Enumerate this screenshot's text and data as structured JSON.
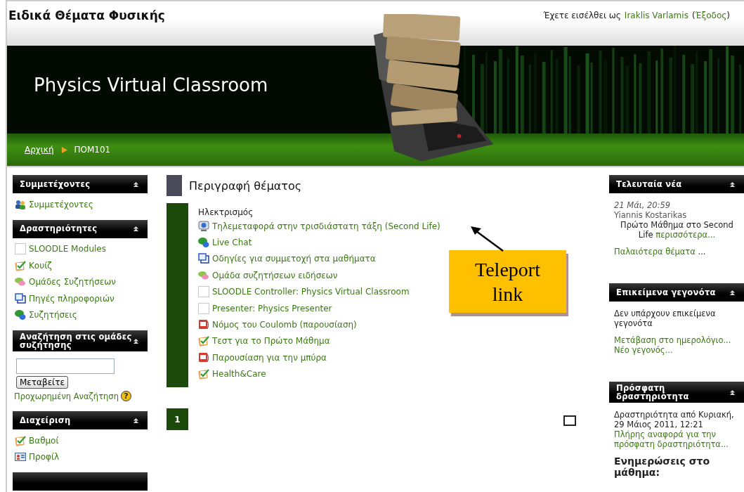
{
  "header": {
    "site_title": "Ειδικά Θέματα Φυσικής",
    "login_prefix": "Έχετε εισέλθει ως",
    "user": "Iraklis Varlamis",
    "logout_open": "(",
    "logout": "Έξοδος",
    "logout_close": ")"
  },
  "banner": {
    "title": "Physics Virtual Classroom"
  },
  "breadcrumb": [
    {
      "label": "Αρχική",
      "kind": "link"
    },
    {
      "label": "ΠΟΜ101",
      "kind": "current"
    }
  ],
  "left_blocks": [
    {
      "kind": "links",
      "title": "Συμμετέχοντες",
      "items": [
        {
          "kind": "participants",
          "label": "Συμμετέχοντες"
        }
      ]
    },
    {
      "kind": "links",
      "title": "Δραστηριότητες",
      "items": [
        {
          "kind": "blank",
          "label": "SLOODLE Modules"
        },
        {
          "kind": "quiz",
          "label": "Κουίζ"
        },
        {
          "kind": "forum",
          "label": "Ομάδες Συζητήσεων"
        },
        {
          "kind": "resource",
          "label": "Πηγές πληροφοριών"
        },
        {
          "kind": "chat",
          "label": "Συζητήσεις"
        }
      ]
    },
    {
      "kind": "search",
      "title": "Αναζήτηση στις ομάδες συζήτησης",
      "button": "Μεταβείτε",
      "advanced": "Προχωρημένη Αναζήτηση",
      "help_icon": "?"
    },
    {
      "kind": "links",
      "title": "Διαχείριση",
      "items": [
        {
          "kind": "quiz",
          "label": "Βαθμοί"
        },
        {
          "kind": "profile",
          "label": "Προφίλ"
        }
      ]
    }
  ],
  "section": {
    "title": "Περιγραφή θέματος",
    "summary": "Ηλεκτρισμός",
    "activities": [
      {
        "kind": "teleport",
        "label": "Τηλεμεταφορά στην τρισδιάστατη τάξη (Second Life)"
      },
      {
        "kind": "chat",
        "label": "Live Chat"
      },
      {
        "kind": "resource",
        "label": "Οδηγίες για συμμετοχή στα μαθήματα"
      },
      {
        "kind": "forum",
        "label": "Ομάδα συζητήσεων ειδήσεων"
      },
      {
        "kind": "blank",
        "label": "SLOODLE Controller: Physics Virtual Classroom"
      },
      {
        "kind": "blank",
        "label": "Presenter: Physics Presenter"
      },
      {
        "kind": "presentation",
        "label": "Νόμος του Coulomb (παρουσίαση)"
      },
      {
        "kind": "quiz",
        "label": "Τεστ για το Πρώτο Μάθημα"
      },
      {
        "kind": "presentation",
        "label": "Παρουσίαση για την μπύρα"
      },
      {
        "kind": "quiz",
        "label": "Health&Care"
      }
    ],
    "section_number": "1"
  },
  "right_blocks": [
    {
      "title": "Τελευταία νέα",
      "paragraphs": [
        [
          {
            "kind": "date",
            "text": "21 Μάι, 20:59"
          },
          {
            "kind": "author",
            "text": "Yiannis Kostarikas"
          },
          {
            "kind": "body",
            "text": "Πρώτο Μάθημα στο Second Life",
            "link": "περισσότερα..."
          }
        ],
        [
          {
            "kind": "link",
            "text": "Παλαιότερα θέματα",
            "suffix": "..."
          }
        ]
      ]
    },
    {
      "title": "Επικείμενα γεγονότα",
      "paragraphs": [
        [
          {
            "kind": "text",
            "text": "Δεν υπάρχουν επικείμενα γεγονότα"
          }
        ],
        [
          {
            "kind": "link",
            "text": "Μετάβαση στο ημερολόγιο..."
          },
          {
            "kind": "link",
            "text": "Νέο γεγονός..."
          }
        ]
      ]
    },
    {
      "title": "Πρόσφατη δραστηριότητα",
      "paragraphs": [
        [
          {
            "kind": "text",
            "text": "Δραστηριότητα από Κυριακή, 29 Μάιος 2011, 12:21"
          },
          {
            "kind": "link",
            "text": "Πλήρης αναφορά για την πρόσφατη δραστηριότητα..."
          }
        ],
        [
          {
            "kind": "heading",
            "text": "Ενημερώσεις στο μάθημα:"
          }
        ]
      ]
    }
  ],
  "annotation": {
    "text": "Teleport link"
  }
}
